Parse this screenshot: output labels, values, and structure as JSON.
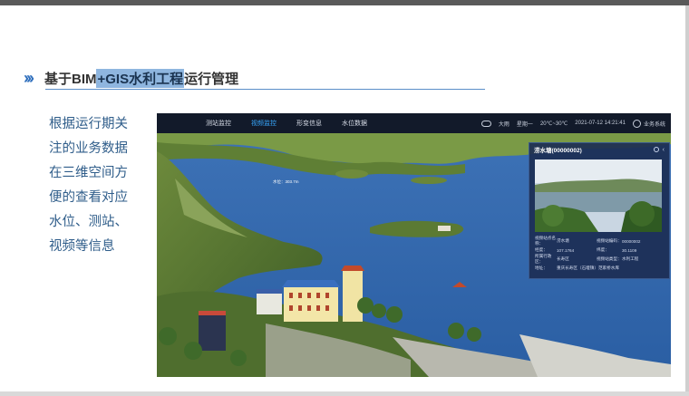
{
  "slide": {
    "title_prefix": "基于BIM",
    "title_highlight": "+GIS水利工程",
    "title_suffix": "运行管理",
    "description": [
      "根据运行期关",
      "注的业务数据",
      "在三维空间方",
      "便的查看对应",
      "水位、测站、",
      "视频等信息"
    ]
  },
  "app": {
    "nav": [
      {
        "label": "测站监控",
        "active": false
      },
      {
        "label": "视频监控",
        "active": true
      },
      {
        "label": "形变信息",
        "active": false
      },
      {
        "label": "水位数据",
        "active": false
      }
    ],
    "status": {
      "weather": "大雨",
      "day": "星期一",
      "temp": "20℃~30℃",
      "datetime": "2021-07-12 14:21:41",
      "system": "业务系统"
    },
    "map_label": "水位：303.7m",
    "card": {
      "title": "涝水塘(00000002)",
      "fields": [
        {
          "l1": "视频站点名称：",
          "v1": "涝水塘",
          "l2": "视频站编码：",
          "v2": "00000002"
        },
        {
          "l1": "经度：",
          "v1": "107.1764",
          "l2": "纬度：",
          "v2": "30.1109"
        },
        {
          "l1": "所属行政区：",
          "v1": "长寿区",
          "l2": "视频站类型：",
          "v2": "水利工程"
        }
      ],
      "address_label": "地址：",
      "address": "重庆长寿区（石堰镇）范家桥水库"
    }
  },
  "colors": {
    "accent": "#2f6fbd",
    "nav_active": "#38a8ff"
  }
}
